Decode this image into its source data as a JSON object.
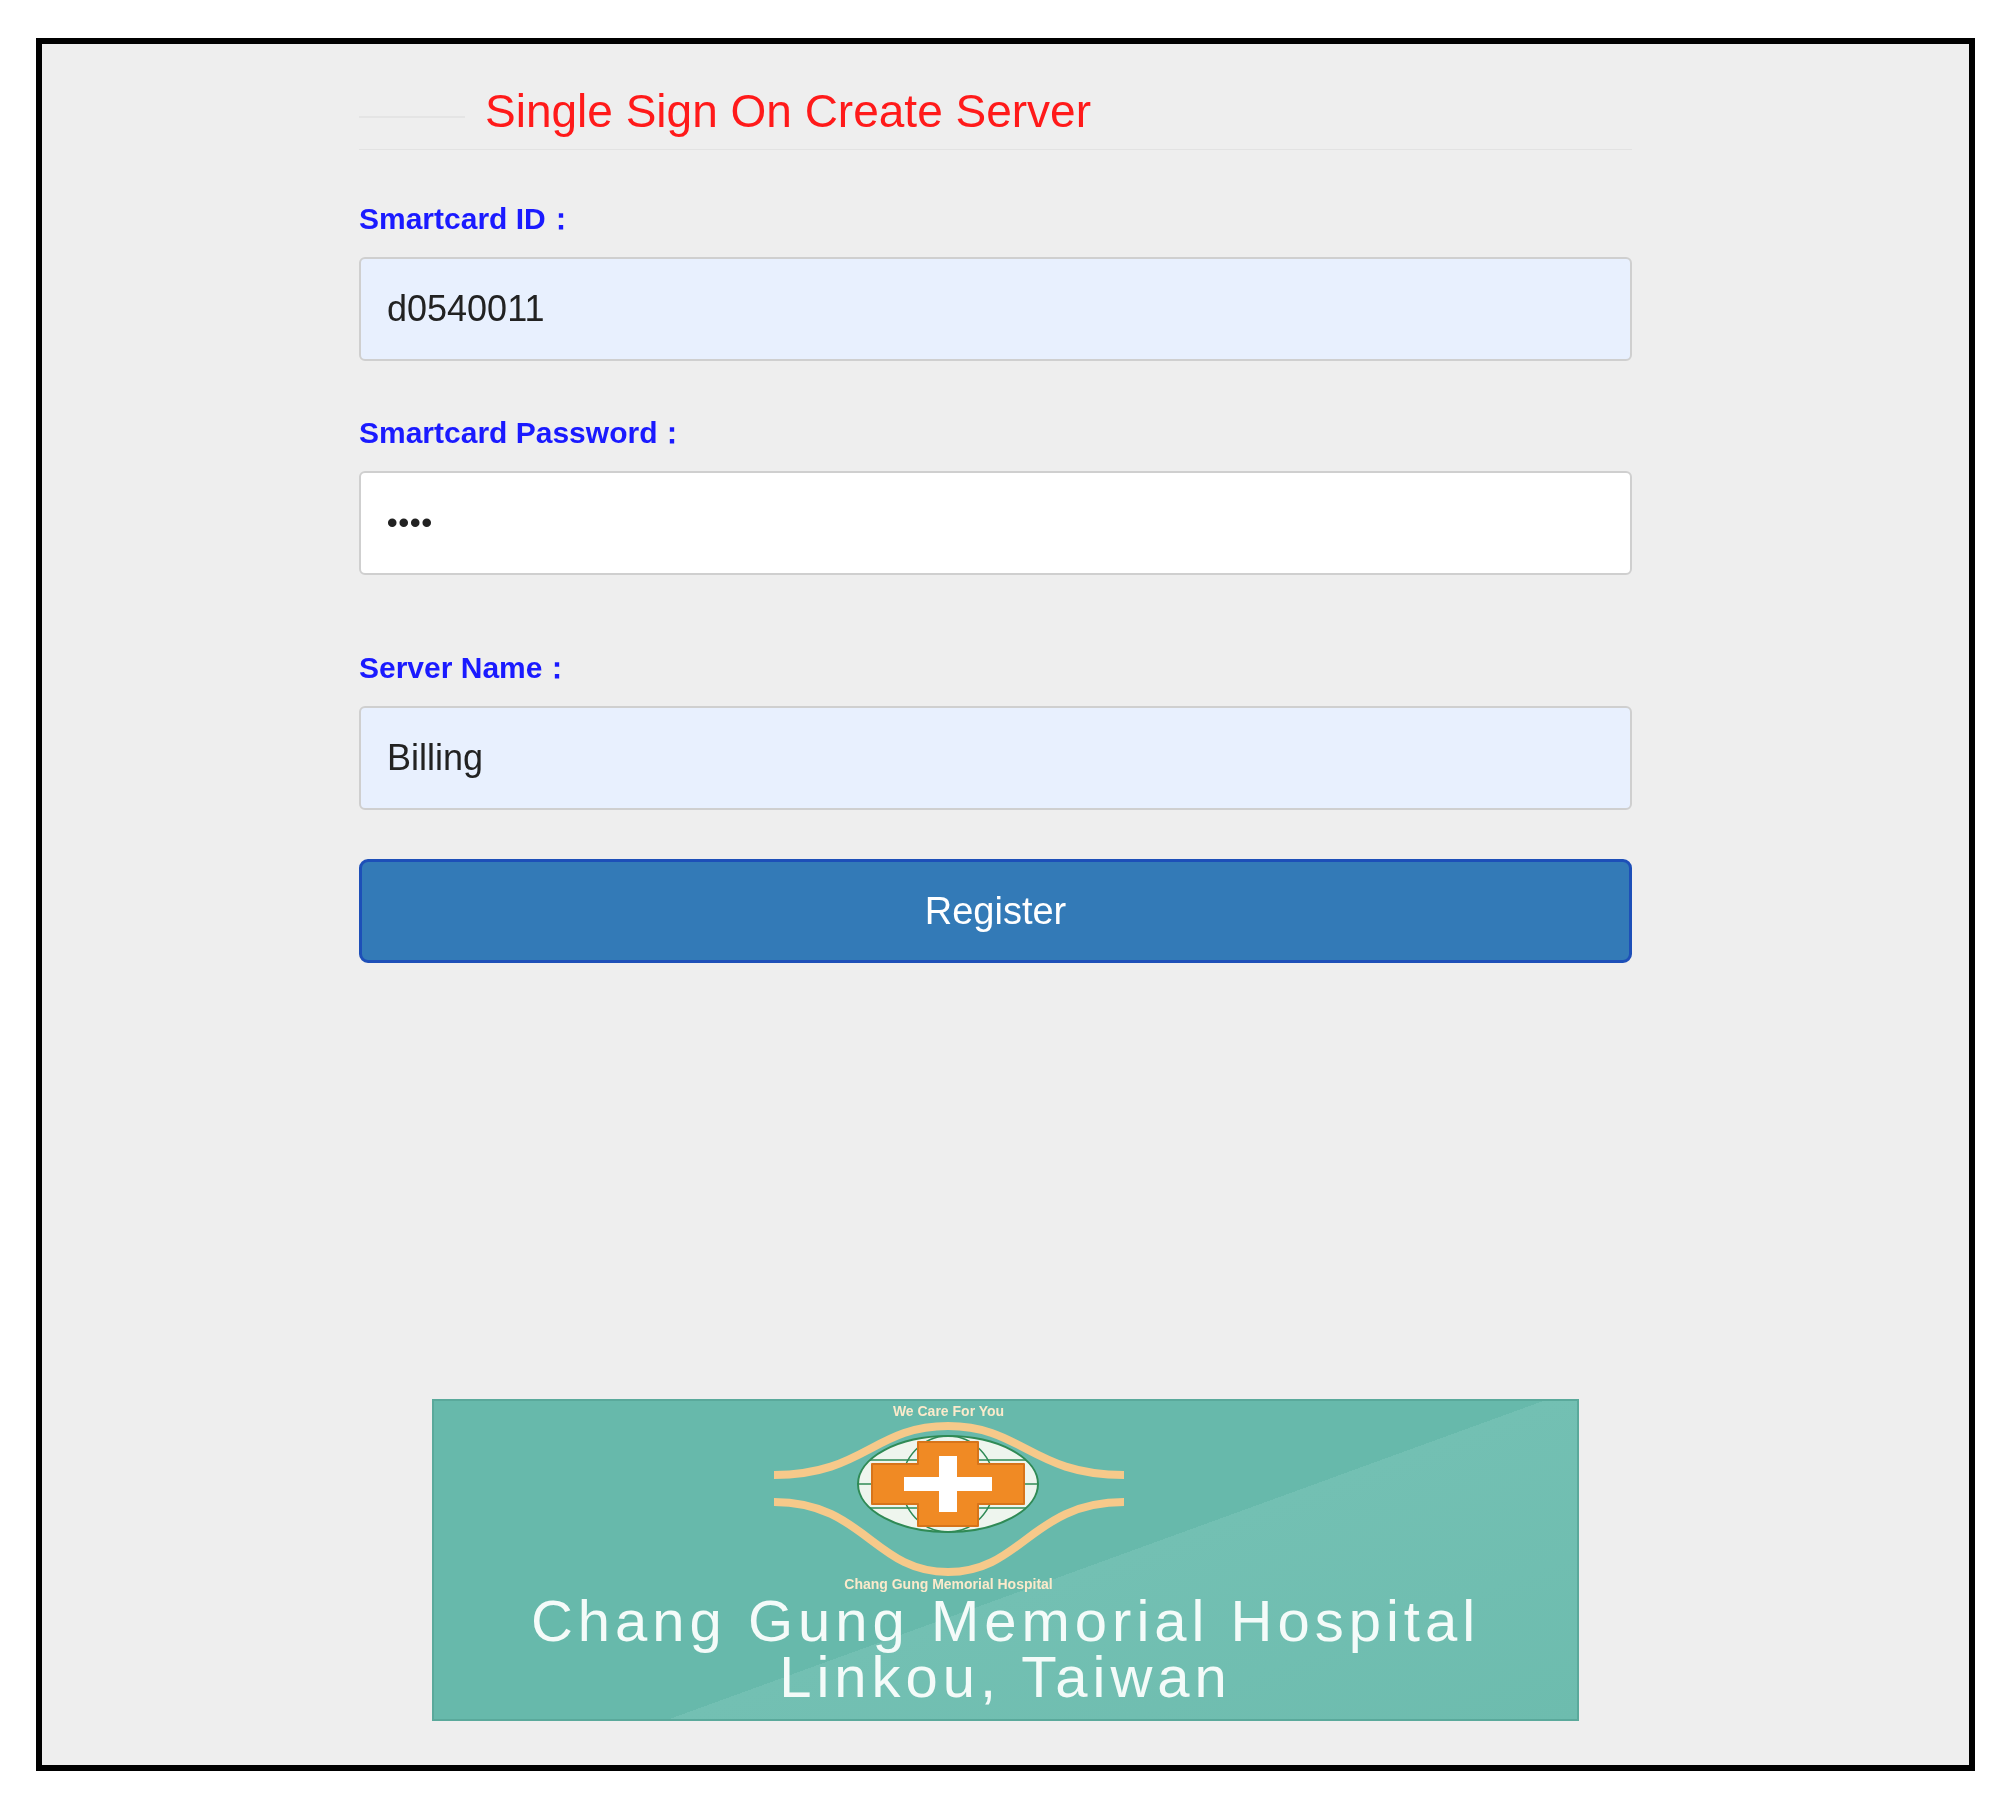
{
  "title": "Single Sign On Create Server",
  "fields": [
    {
      "label": "Smartcard ID：",
      "value": "d0540011",
      "kind": "text",
      "autofilled": true
    },
    {
      "label": "Smartcard Password：",
      "value": "••••",
      "kind": "password",
      "autofilled": false
    },
    {
      "label": "Server Name：",
      "value": "Billing",
      "kind": "text",
      "autofilled": true
    }
  ],
  "button": "Register",
  "banner": {
    "motto": "We Care For You",
    "ring_text": "Chang Gung Memorial Hospital",
    "lines": [
      "Chang Gung Memorial Hospital",
      "Linkou, Taiwan"
    ]
  }
}
